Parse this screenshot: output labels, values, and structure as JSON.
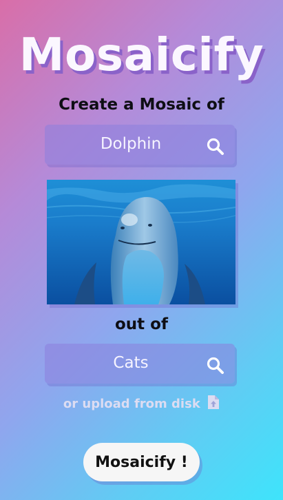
{
  "app": {
    "title": "Mosaicify"
  },
  "target": {
    "prompt": "Create a Mosaic of",
    "query": "Dolphin",
    "image_alt": "dolphin"
  },
  "source": {
    "prompt": "out of",
    "query": "Cats"
  },
  "upload": {
    "label": "or upload from disk"
  },
  "submit": {
    "label": "Mosaicify !"
  },
  "colors": {
    "title_shadow": "#8a62c9",
    "input_bg": "#8d80dc",
    "button_bg": "#f6f6f6"
  },
  "icons": {
    "search": "search-icon",
    "upload": "file-upload-icon"
  }
}
